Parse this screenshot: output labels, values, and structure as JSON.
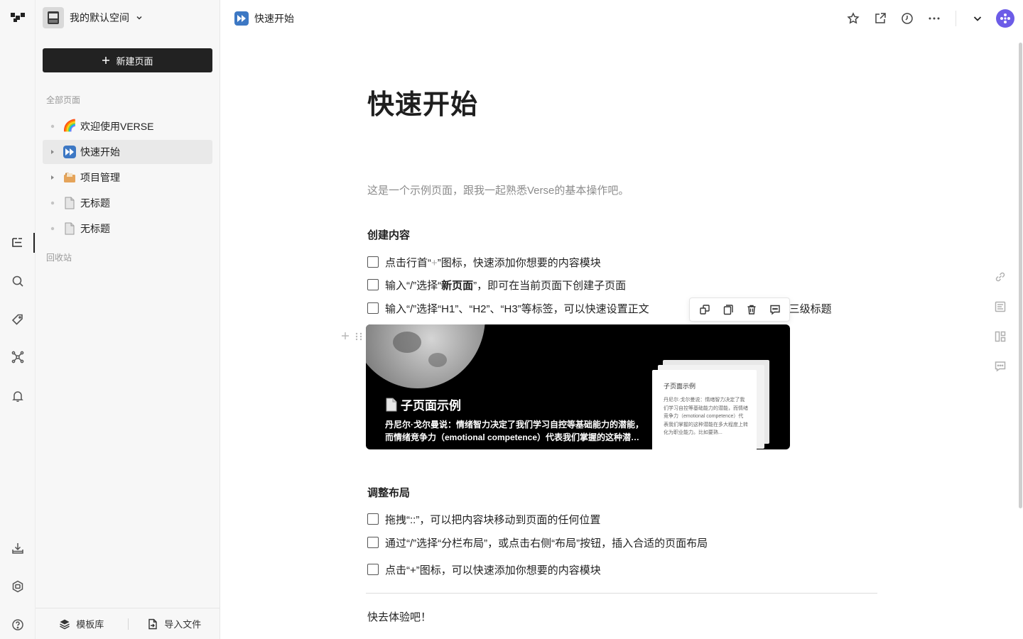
{
  "workspace": {
    "name": "我的默认空间"
  },
  "sidebar": {
    "new_page_label": "新建页面",
    "all_pages_label": "全部页面",
    "trash_label": "回收站",
    "items": [
      {
        "emoji": "🌈",
        "label": "欢迎使用VERSE",
        "expandable": false,
        "active": false
      },
      {
        "emoji": "⏩",
        "label": "快速开始",
        "expandable": true,
        "active": true
      },
      {
        "emoji": "🗂️",
        "label": "项目管理",
        "expandable": true,
        "active": false
      },
      {
        "emoji": "📄",
        "label": "无标题",
        "expandable": false,
        "active": false
      },
      {
        "emoji": "📄",
        "label": "无标题",
        "expandable": false,
        "active": false
      }
    ],
    "footer": {
      "templates_label": "模板库",
      "import_label": "导入文件"
    }
  },
  "topbar": {
    "breadcrumb": "快速开始",
    "actions": [
      "star-icon",
      "share-icon",
      "history-icon",
      "more-icon",
      "chevron-down-icon",
      "avatar"
    ]
  },
  "doc": {
    "title": "快速开始",
    "description": "这是一个示例页面，跟我一起熟悉Verse的基本操作吧。",
    "section1": {
      "heading": "创建内容",
      "todo1_pre": "点击行首“",
      "todo1_plus": "+",
      "todo1_post": "”图标，快速添加你想要的内容模块",
      "todo2_pre": "输入“/”选择“",
      "todo2_bold": "新页面",
      "todo2_post": "”，即可在当前页面下创建子页面",
      "todo3_text": "输入“/”选择“H1”、“H2”、“H3”等标签，可以快速设置正文",
      "todo3_tail": "、三级标题"
    },
    "subpage_card": {
      "title": "子页面示例",
      "excerpt": "丹尼尔·戈尔曼说：情绪智力决定了我们学习自控等基础能力的潜能，而情绪竞争力（emotional competence）代表我们掌握的这种潜能在多大程度上转化为职业能力。比如要熟练",
      "mini_title": "子页面示例",
      "mini_text": "丹尼尔·戈尔曼说：情绪智力决定了我们学习自控等基础能力的潜能，而情绪竞争力（emotional competence）代表我们掌握的这种潜能在多大程度上转化为职业能力。比如要熟..."
    },
    "section2": {
      "heading": "调整布局",
      "todos": [
        "拖拽“::”，可以把内容块移动到页面的任何位置",
        "通过“/”选择“分栏布局”，或点击右侧“布局”按钮，插入合适的页面布局",
        "点击“+”图标，可以快速添加你想要的内容模块"
      ]
    },
    "closing": "快去体验吧！"
  },
  "colors": {
    "accent_dark": "#222222",
    "breadcrumb_icon": "#3d78c4",
    "avatar": "#6c5ce7"
  }
}
